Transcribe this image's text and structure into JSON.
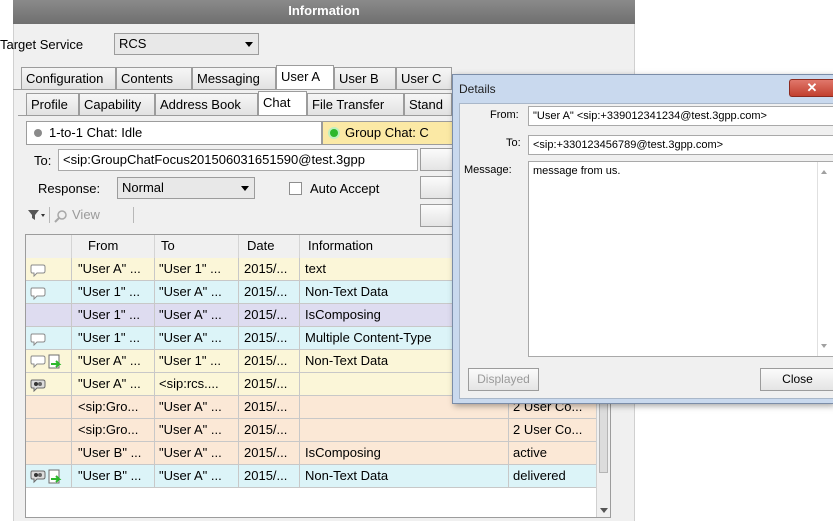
{
  "window": {
    "title": "Information"
  },
  "target": {
    "label": "Target Service",
    "value": "RCS"
  },
  "main_tabs": [
    "Configuration",
    "Contents",
    "Messaging",
    "User A",
    "User B",
    "User C"
  ],
  "sub_tabs": [
    "Profile",
    "Capability",
    "Address Book",
    "Chat",
    "File Transfer",
    "Stand"
  ],
  "status": {
    "one_to_one": "1-to-1 Chat: Idle",
    "group": "Group Chat: C"
  },
  "to": {
    "label": "To:",
    "value": "<sip:GroupChatFocus201506031651590@test.3gpp"
  },
  "response": {
    "label": "Response:",
    "value": "Normal"
  },
  "auto_accept": {
    "label": "Auto Accept"
  },
  "toolbar": {
    "view_label": "View"
  },
  "table": {
    "headers": [
      "",
      "From",
      "To",
      "Date",
      "Information",
      ""
    ],
    "rows": [
      {
        "icon": "bubble",
        "from": "\"User A\" ...",
        "to": "\"User 1\" ...",
        "date": "2015/...",
        "info": "text",
        "extra": "",
        "color": "#fbf6d8"
      },
      {
        "icon": "bubble",
        "from": "\"User 1\" ...",
        "to": "\"User A\" ...",
        "date": "2015/...",
        "info": "Non-Text Data",
        "extra": "",
        "color": "#dcf4f8"
      },
      {
        "icon": "",
        "from": "\"User 1\" ...",
        "to": "\"User A\" ...",
        "date": "2015/...",
        "info": "IsComposing",
        "extra": "",
        "color": "#dedcf0"
      },
      {
        "icon": "bubble",
        "from": "\"User 1\" ...",
        "to": "\"User A\" ...",
        "date": "2015/...",
        "info": "Multiple Content-Type",
        "extra": "",
        "color": "#dcf4f8"
      },
      {
        "icon": "bubble-file",
        "from": "\"User A\" ...",
        "to": "\"User 1\" ...",
        "date": "2015/...",
        "info": "Non-Text Data",
        "extra": "",
        "color": "#fbf6d8"
      },
      {
        "icon": "group-bubble",
        "from": "\"User A\" ...",
        "to": "<sip:rcs....",
        "date": "2015/...",
        "info": "",
        "extra": "",
        "color": "#fbf6d8"
      },
      {
        "icon": "",
        "from": "<sip:Gro...",
        "to": "\"User A\" ...",
        "date": "2015/...",
        "info": "",
        "extra": "2 User Co...",
        "color": "#fbe8d6"
      },
      {
        "icon": "",
        "from": "<sip:Gro...",
        "to": "\"User A\" ...",
        "date": "2015/...",
        "info": "",
        "extra": "2 User Co...",
        "color": "#fbe8d6"
      },
      {
        "icon": "",
        "from": "\"User B\" ...",
        "to": "\"User A\" ...",
        "date": "2015/...",
        "info": "IsComposing",
        "extra": "active",
        "color": "#fbe8d6"
      },
      {
        "icon": "group-bubble-file",
        "from": "\"User B\" ...",
        "to": "\"User A\" ...",
        "date": "2015/...",
        "info": "Non-Text Data",
        "extra": "delivered",
        "color": "#dcf4f8"
      }
    ]
  },
  "details": {
    "title": "Details",
    "from_label": "From:",
    "from_value": "\"User A\" <sip:+339012341234@test.3gpp.com>",
    "to_label": "To:",
    "to_value": "<sip:+330123456789@test.3gpp.com>",
    "message_label": "Message:",
    "message_value": "message from us.",
    "displayed_button": "Displayed",
    "close_button": "Close"
  },
  "colors": {
    "title_bar": "#777777",
    "green_dot": "#2db82d",
    "group_status_bg": "#fbe9a5",
    "close_x_bg": "#c9483c"
  }
}
